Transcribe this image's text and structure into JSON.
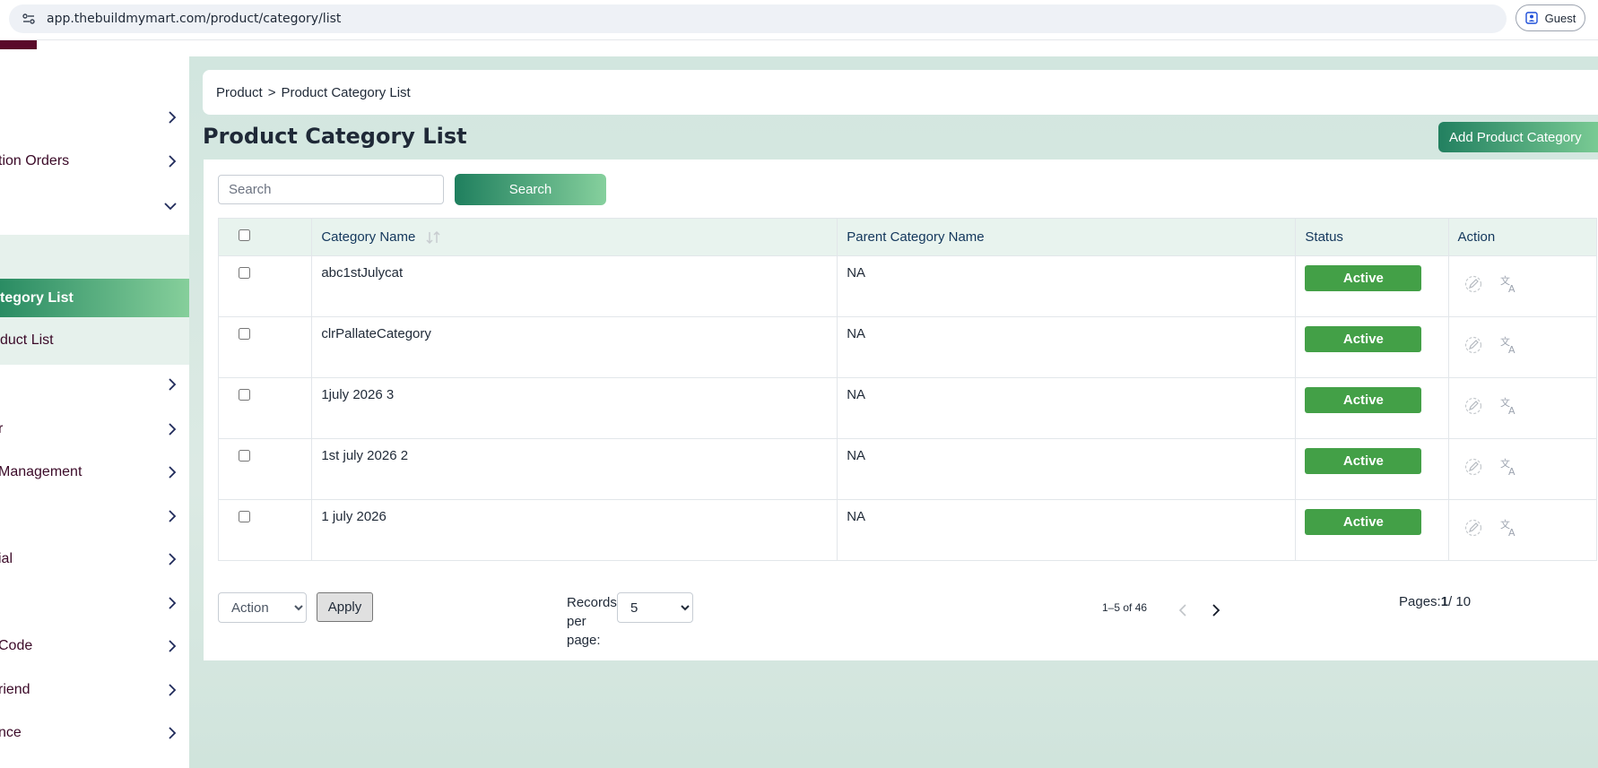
{
  "browser": {
    "url": "app.thebuildmymart.com/product/category/list",
    "profile_label": "Guest"
  },
  "sidebar": {
    "items": [
      {
        "label": "",
        "top": 0
      },
      {
        "label": "tion Orders"
      },
      {
        "label": ""
      },
      {
        "label": ""
      },
      {
        "label": "r"
      },
      {
        "label": "Management"
      },
      {
        "label": ""
      },
      {
        "label": "ial"
      },
      {
        "label": ""
      },
      {
        "label": "Code"
      },
      {
        "label": "riend"
      },
      {
        "label": "nce"
      }
    ],
    "subitems": [
      {
        "label": "tegory List",
        "active": true
      },
      {
        "label": "duct List",
        "active": false
      }
    ]
  },
  "breadcrumb": {
    "root": "Product",
    "separator": ">",
    "current": "Product Category List"
  },
  "page": {
    "title": "Product Category List",
    "add_button": "Add Product Category"
  },
  "search": {
    "placeholder": "Search",
    "button": "Search"
  },
  "table": {
    "headers": {
      "name": "Category Name",
      "parent": "Parent Category Name",
      "status": "Status",
      "action": "Action"
    },
    "rows": [
      {
        "name": "abc1stJulycat",
        "parent": "NA",
        "status": "Active"
      },
      {
        "name": "clrPallateCategory",
        "parent": "NA",
        "status": "Active"
      },
      {
        "name": "1july 2026 3",
        "parent": "NA",
        "status": "Active"
      },
      {
        "name": "1st july 2026 2",
        "parent": "NA",
        "status": "Active"
      },
      {
        "name": "1 july 2026",
        "parent": "NA",
        "status": "Active"
      }
    ]
  },
  "footer": {
    "bulk_action": "Action",
    "apply": "Apply",
    "records_label": "Records per page:",
    "records_value": "5",
    "range": "1–5 of 46",
    "pages_label": "Pages:",
    "current_page": "1",
    "total_pages": "/ 10"
  },
  "colors": {
    "accent_green": "#43a047",
    "brand_maroon": "#5a0a2a",
    "header_bg": "#e8f3ee"
  }
}
